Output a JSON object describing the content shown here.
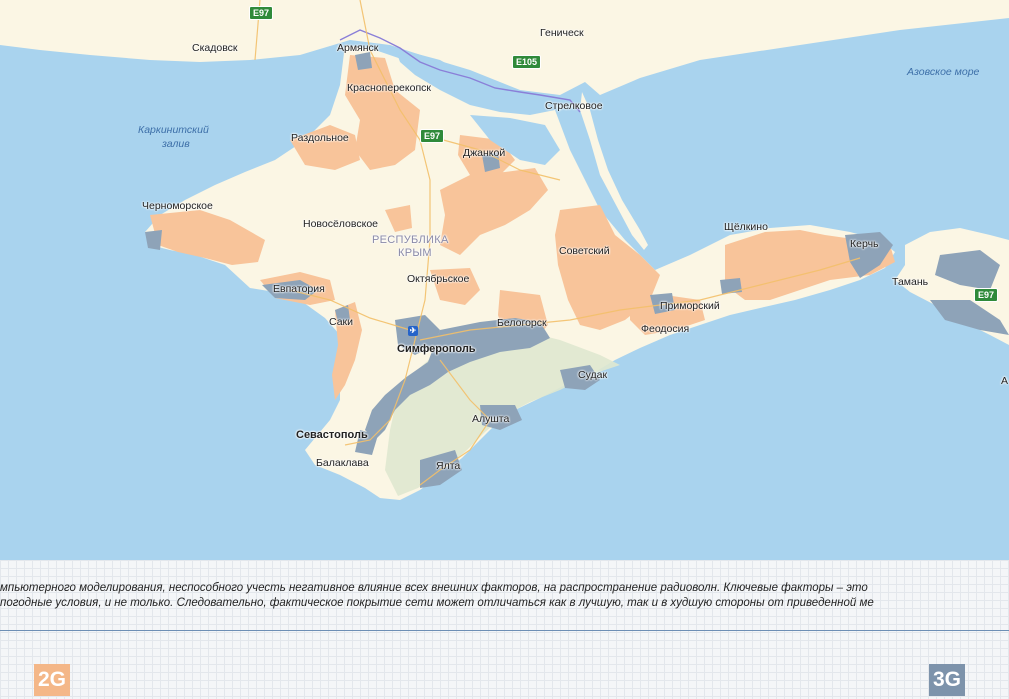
{
  "map": {
    "water_labels": {
      "azov": "Азовское море",
      "karkinit_1": "Каркинитский",
      "karkinit_2": "залив"
    },
    "region_label": {
      "line1": "РЕСПУБЛИКА",
      "line2": "КРЫМ"
    },
    "cities": {
      "skadovsk": "Скадовск",
      "armyansk": "Армянск",
      "genichesk": "Геническ",
      "krasnoperekopsk": "Красноперекопск",
      "strelkovoe": "Стрелковое",
      "razdolnoe": "Раздольное",
      "dzhankoy": "Джанкой",
      "chernomorskoe": "Черноморское",
      "novoselovskoe": "Новосёловское",
      "sovetsky": "Советский",
      "shchelkino": "Щёлкино",
      "kerch": "Керчь",
      "oktyabrskoe": "Октябрьское",
      "evpatoria": "Евпатория",
      "saki": "Саки",
      "belogorsk": "Белогорск",
      "primorsky": "Приморский",
      "feodosia": "Феодосия",
      "taman": "Тамань",
      "simferopol": "Симферополь",
      "sudak": "Судак",
      "alushta": "Алушта",
      "sevastopol": "Севастополь",
      "balaklava": "Балаклава",
      "yalta": "Ялта",
      "edge_a": "А"
    },
    "roads": {
      "e97_top": "E97",
      "e105": "E105",
      "e97_mid": "E97",
      "e97_east": "E97"
    },
    "colors": {
      "sea": "#a9d3ee",
      "land": "#fbf6e4",
      "coverage_2g": "#f8c49a",
      "coverage_3g": "#8ea3b8",
      "mountains": "#dfe8cf"
    }
  },
  "disclaimer": {
    "line1": "мпьютерного моделирования, неспособного учесть негативное влияние всех внешних факторов, на распространение радиоволн. Ключевые факторы – это",
    "line2": "погодные условия, и не только. Следовательно, фактическое покрытие сети может отличаться как в лучшую, так и в худшую стороны от приведенной ме"
  },
  "legend": {
    "label_2g": "2G",
    "label_3g": "3G",
    "color_2g": "#f4b788",
    "color_3g": "#7d93ab"
  }
}
